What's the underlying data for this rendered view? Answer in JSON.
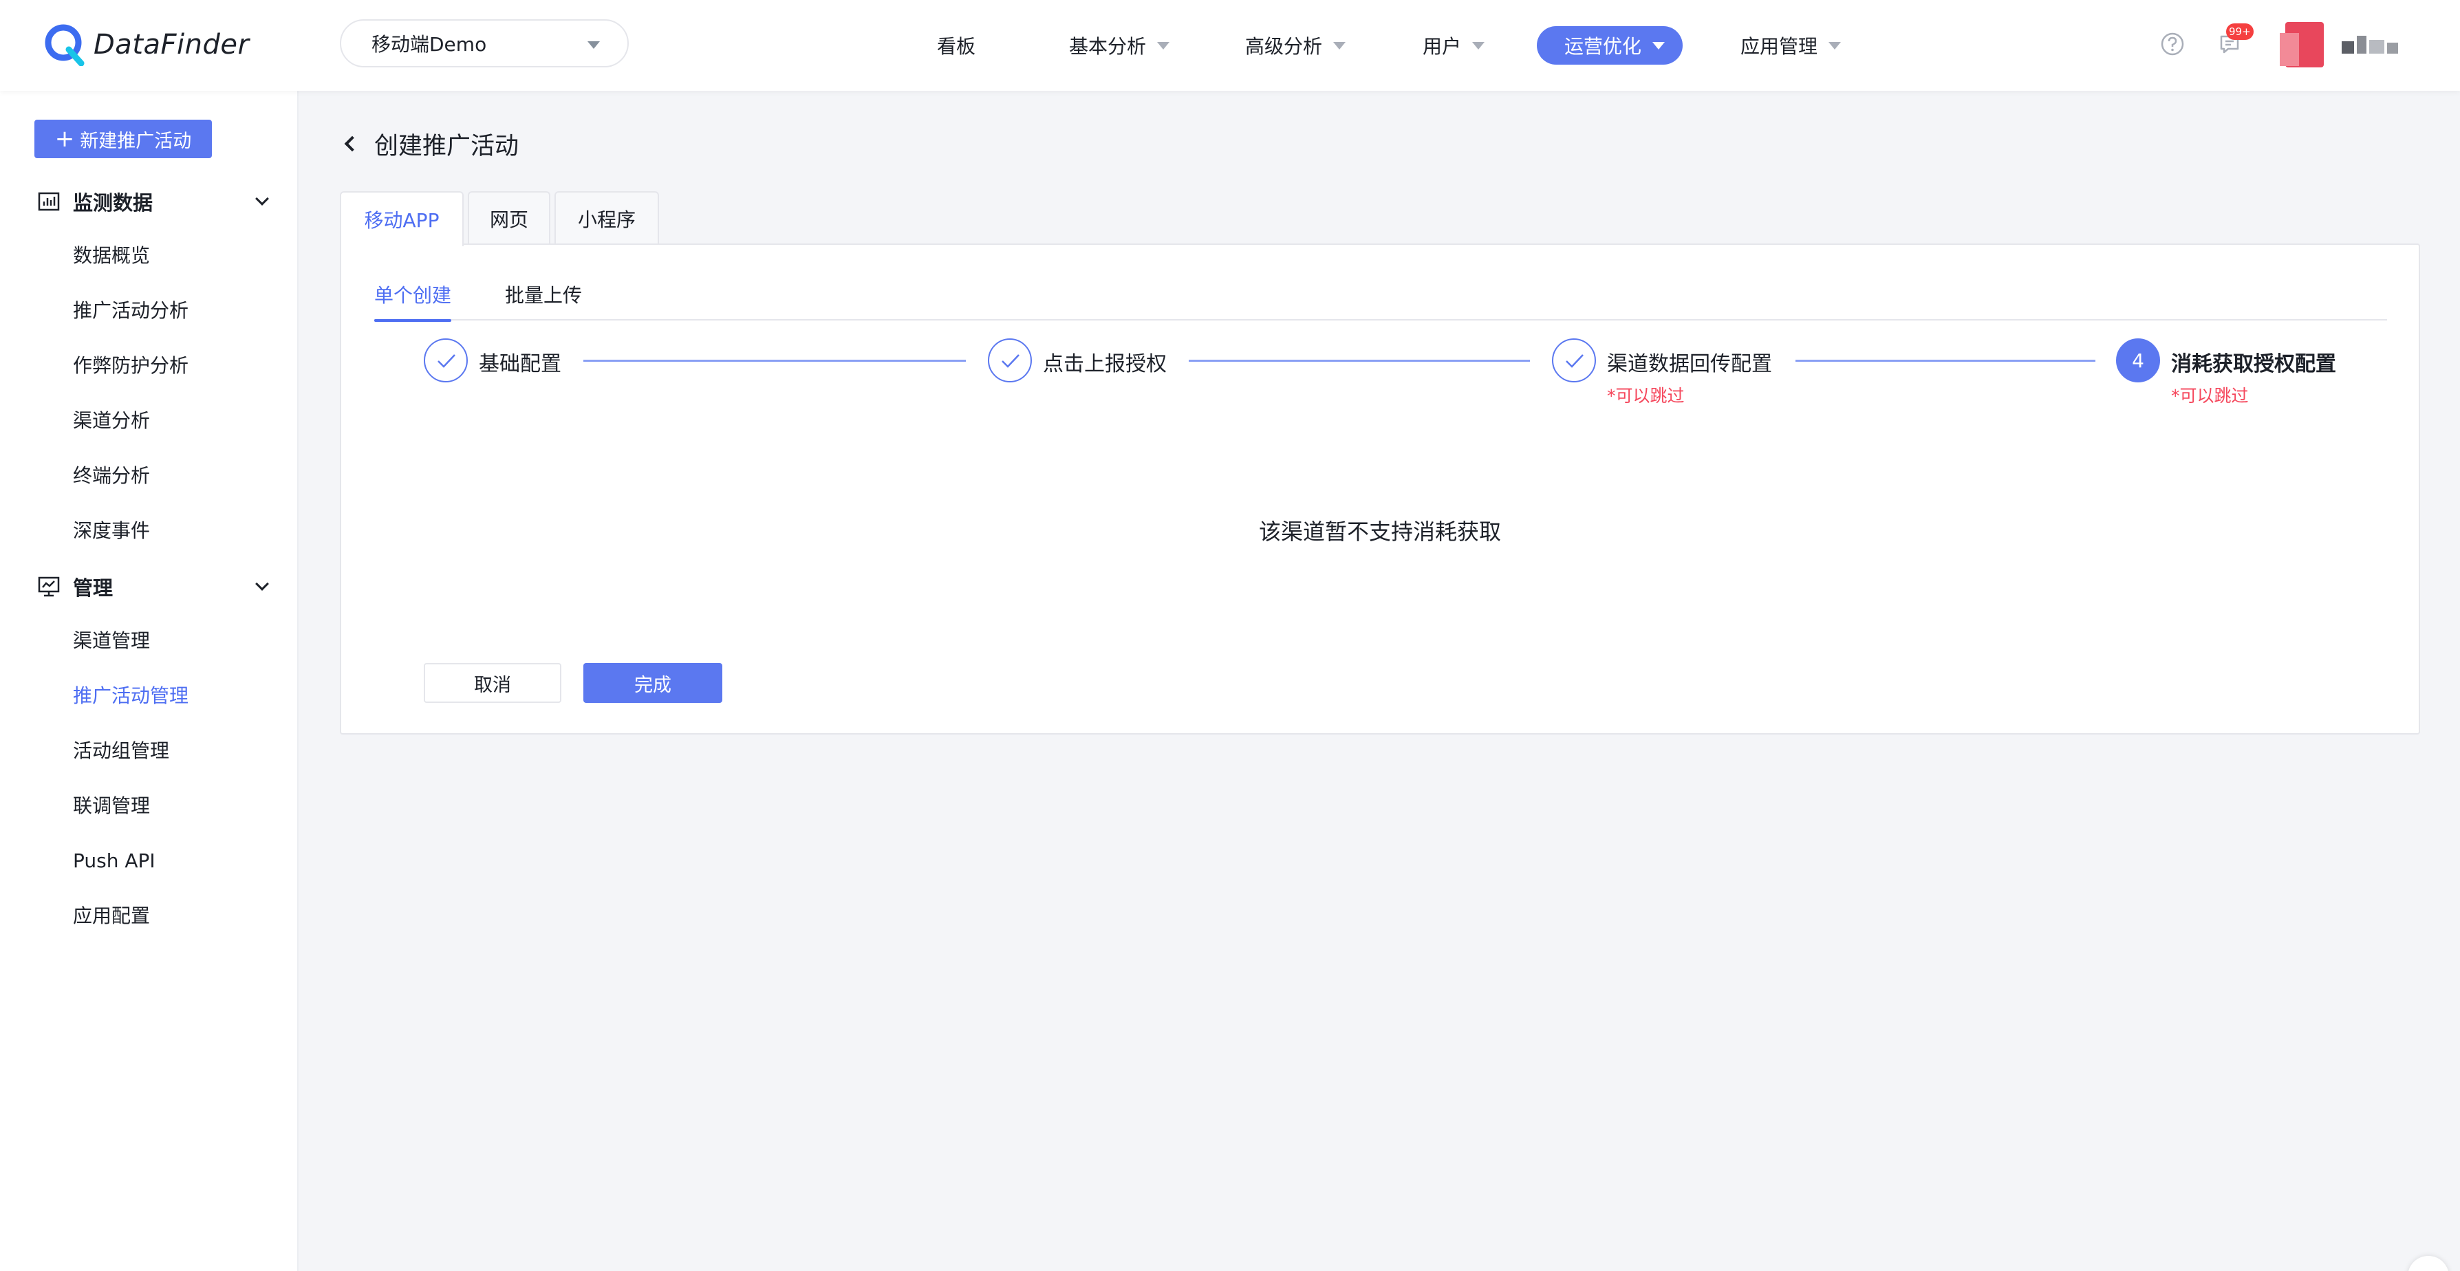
{
  "header": {
    "logo_text": "DataFinder",
    "app_select_value": "移动端Demo",
    "nav": [
      {
        "label": "看板"
      },
      {
        "label": "基本分析"
      },
      {
        "label": "高级分析"
      },
      {
        "label": "用户"
      },
      {
        "label": "运营优化"
      },
      {
        "label": "应用管理"
      }
    ],
    "notification_badge": "99+",
    "accent_color": "#5b78f0"
  },
  "sidebar": {
    "new_button_label": "新建推广活动",
    "groups": [
      {
        "label": "监测数据",
        "icon": "bar-chart-icon"
      },
      {
        "label": "管理",
        "icon": "monitor-chart-icon"
      }
    ],
    "monitor_items": [
      "数据概览",
      "推广活动分析",
      "作弊防护分析",
      "渠道分析",
      "终端分析",
      "深度事件"
    ],
    "manage_items": [
      "渠道管理",
      "推广活动管理",
      "活动组管理",
      "联调管理",
      "Push API",
      "应用配置"
    ],
    "active_item": "推广活动管理"
  },
  "main": {
    "title": "创建推广活动",
    "tabs": [
      {
        "label": "移动APP"
      },
      {
        "label": "网页"
      },
      {
        "label": "小程序"
      }
    ],
    "subtabs": [
      {
        "label": "单个创建"
      },
      {
        "label": "批量上传"
      }
    ],
    "steps": [
      {
        "label": "基础配置",
        "status": "done"
      },
      {
        "label": "点击上报授权",
        "status": "done"
      },
      {
        "label": "渠道数据回传配置",
        "status": "done",
        "note": "*可以跳过"
      },
      {
        "label": "消耗获取授权配置",
        "status": "current",
        "number": "4",
        "note": "*可以跳过"
      }
    ],
    "empty_message": "该渠道暂不支持消耗获取",
    "cancel_label": "取消",
    "finish_label": "完成"
  }
}
